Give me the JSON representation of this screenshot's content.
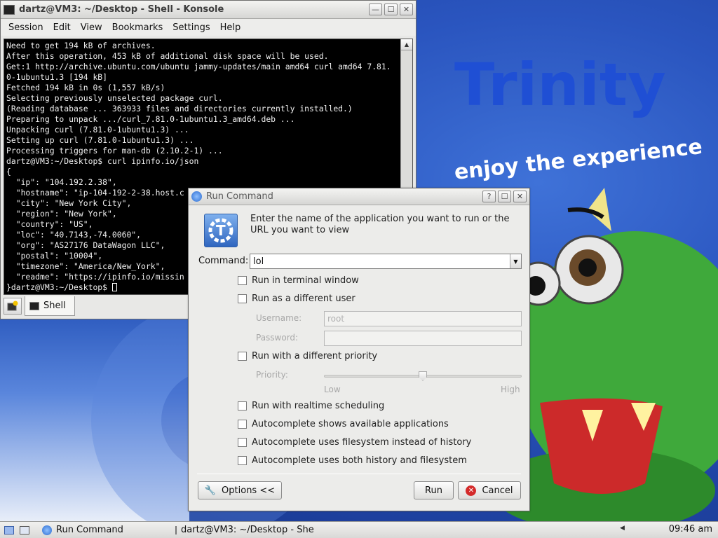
{
  "wallpaper": {
    "logo_text": "Trinity",
    "tagline": "enjoy the experience"
  },
  "konsole": {
    "title": "dartz@VM3: ~/Desktop - Shell - Konsole",
    "menu": [
      "Session",
      "Edit",
      "View",
      "Bookmarks",
      "Settings",
      "Help"
    ],
    "terminal_lines": [
      "Need to get 194 kB of archives.",
      "After this operation, 453 kB of additional disk space will be used.",
      "Get:1 http://archive.ubuntu.com/ubuntu jammy-updates/main amd64 curl amd64 7.81.",
      "0-1ubuntu1.3 [194 kB]",
      "Fetched 194 kB in 0s (1,557 kB/s)",
      "Selecting previously unselected package curl.",
      "(Reading database ... 363933 files and directories currently installed.)",
      "Preparing to unpack .../curl_7.81.0-1ubuntu1.3_amd64.deb ...",
      "Unpacking curl (7.81.0-1ubuntu1.3) ...",
      "Setting up curl (7.81.0-1ubuntu1.3) ...",
      "Processing triggers for man-db (2.10.2-1) ...",
      "dartz@VM3:~/Desktop$ curl ipinfo.io/json",
      "{",
      "  \"ip\": \"104.192.2.38\",",
      "  \"hostname\": \"ip-104-192-2-38.host.c",
      "  \"city\": \"New York City\",",
      "  \"region\": \"New York\",",
      "  \"country\": \"US\",",
      "  \"loc\": \"40.7143,-74.0060\",",
      "  \"org\": \"AS27176 DataWagon LLC\",",
      "  \"postal\": \"10004\",",
      "  \"timezone\": \"America/New_York\",",
      "  \"readme\": \"https://ipinfo.io/missin",
      "}dartz@VM3:~/Desktop$ "
    ],
    "tab_label": "Shell"
  },
  "run_dialog": {
    "title": "Run Command",
    "description": "Enter the name of the application you want to run or the URL you want to view",
    "command_label": "Command:",
    "command_value": "lol",
    "options": {
      "run_in_terminal": "Run in terminal window",
      "run_as_user": "Run as a different user",
      "username_label": "Username:",
      "username_value": "root",
      "password_label": "Password:",
      "run_with_priority": "Run with a different priority",
      "priority_label": "Priority:",
      "priority_low": "Low",
      "priority_high": "High",
      "priority_level": 0.5,
      "realtime": "Run with realtime scheduling",
      "autocomplete_apps": "Autocomplete shows available applications",
      "autocomplete_fs": "Autocomplete uses filesystem instead of history",
      "autocomplete_both": "Autocomplete uses both history and filesystem"
    },
    "buttons": {
      "options": "Options <<",
      "run": "Run",
      "cancel": "Cancel"
    }
  },
  "taskbar": {
    "tasks": [
      "Run Command",
      "dartz@VM3: ~/Desktop - She"
    ],
    "clock": "09:46 am"
  },
  "colors": {
    "wallpaper_blue": "#2a55bf",
    "terminal_bg": "#000000",
    "trinity_blue": "#1f4fd4",
    "trinity_green": "#2e9a2e",
    "trinity_yellow": "#f2c200",
    "dragon_green": "#3fa93b"
  }
}
